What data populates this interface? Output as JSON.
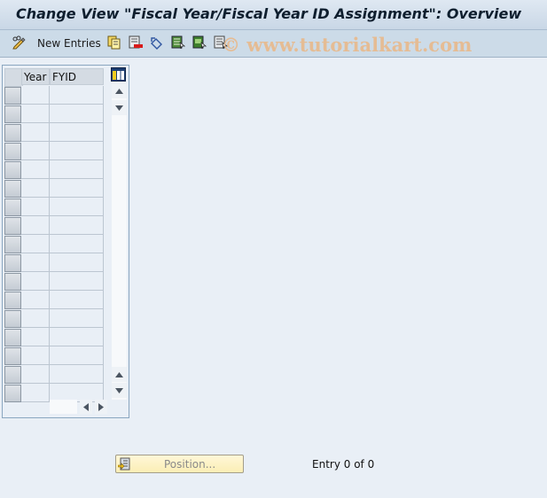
{
  "window": {
    "title": "Change View \"Fiscal Year/Fiscal Year ID Assignment\": Overview"
  },
  "toolbar": {
    "items": [
      {
        "icon": "display-change-icon",
        "label": ""
      },
      {
        "icon": "new-entries",
        "label": "New Entries"
      },
      {
        "icon": "copy-as-icon",
        "label": ""
      },
      {
        "icon": "delete-icon",
        "label": ""
      },
      {
        "icon": "undo-change-icon",
        "label": ""
      },
      {
        "icon": "select-all-icon",
        "label": ""
      },
      {
        "icon": "select-block-icon",
        "label": ""
      },
      {
        "icon": "deselect-all-icon",
        "label": ""
      }
    ],
    "new_entries_label": "New Entries"
  },
  "watermark": "© www.tutorialkart.com",
  "table": {
    "columns": [
      "Year",
      "FYID"
    ],
    "rows": [
      [
        "",
        ""
      ],
      [
        "",
        ""
      ],
      [
        "",
        ""
      ],
      [
        "",
        ""
      ],
      [
        "",
        ""
      ],
      [
        "",
        ""
      ],
      [
        "",
        ""
      ],
      [
        "",
        ""
      ],
      [
        "",
        ""
      ],
      [
        "",
        ""
      ],
      [
        "",
        ""
      ],
      [
        "",
        ""
      ],
      [
        "",
        ""
      ],
      [
        "",
        ""
      ],
      [
        "",
        ""
      ],
      [
        "",
        ""
      ],
      [
        "",
        ""
      ]
    ]
  },
  "footer": {
    "position_button_label": "Position...",
    "entry_status": "Entry 0 of 0"
  }
}
